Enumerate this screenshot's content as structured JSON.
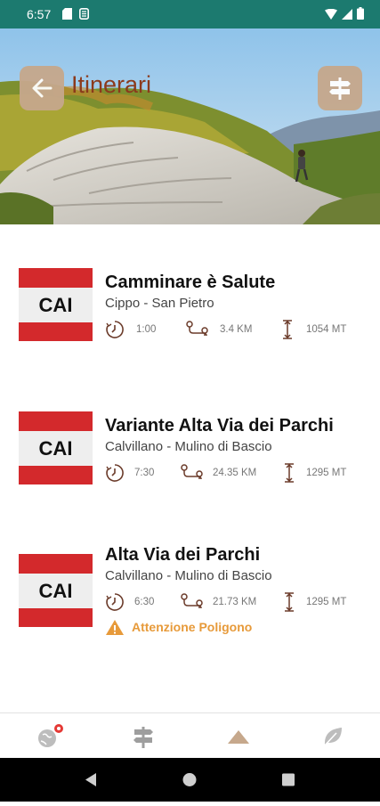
{
  "status": {
    "time": "6:57"
  },
  "header": {
    "title": "Itinerari"
  },
  "items": [
    {
      "badge": "CAI",
      "name": "Camminare è Salute",
      "route": "Cippo - San Pietro",
      "duration": "1:00",
      "distance": "3.4 KM",
      "elevation": "1054 MT",
      "warning": ""
    },
    {
      "badge": "CAI",
      "name": "Variante Alta Via dei Parchi",
      "route": "Calvillano - Mulino di Bascio",
      "duration": "7:30",
      "distance": "24.35 KM",
      "elevation": "1295 MT",
      "warning": ""
    },
    {
      "badge": "CAI",
      "name": "Alta Via dei Parchi",
      "route": "Calvillano - Mulino di Bascio",
      "duration": "6:30",
      "distance": "21.73 KM",
      "elevation": "1295 MT",
      "warning": "Attenzione Poligono"
    }
  ],
  "nav": {
    "items": [
      {
        "icon": "map-pin-globe-icon"
      },
      {
        "icon": "signpost-icon"
      },
      {
        "icon": "mountain-icon"
      },
      {
        "icon": "leaf-icon"
      }
    ]
  },
  "colors": {
    "status_bar": "#1c7a6f",
    "accent": "#c6a88c",
    "cai_red": "#d3292c",
    "warning": "#e79a3a",
    "title": "#8b3a1c"
  }
}
